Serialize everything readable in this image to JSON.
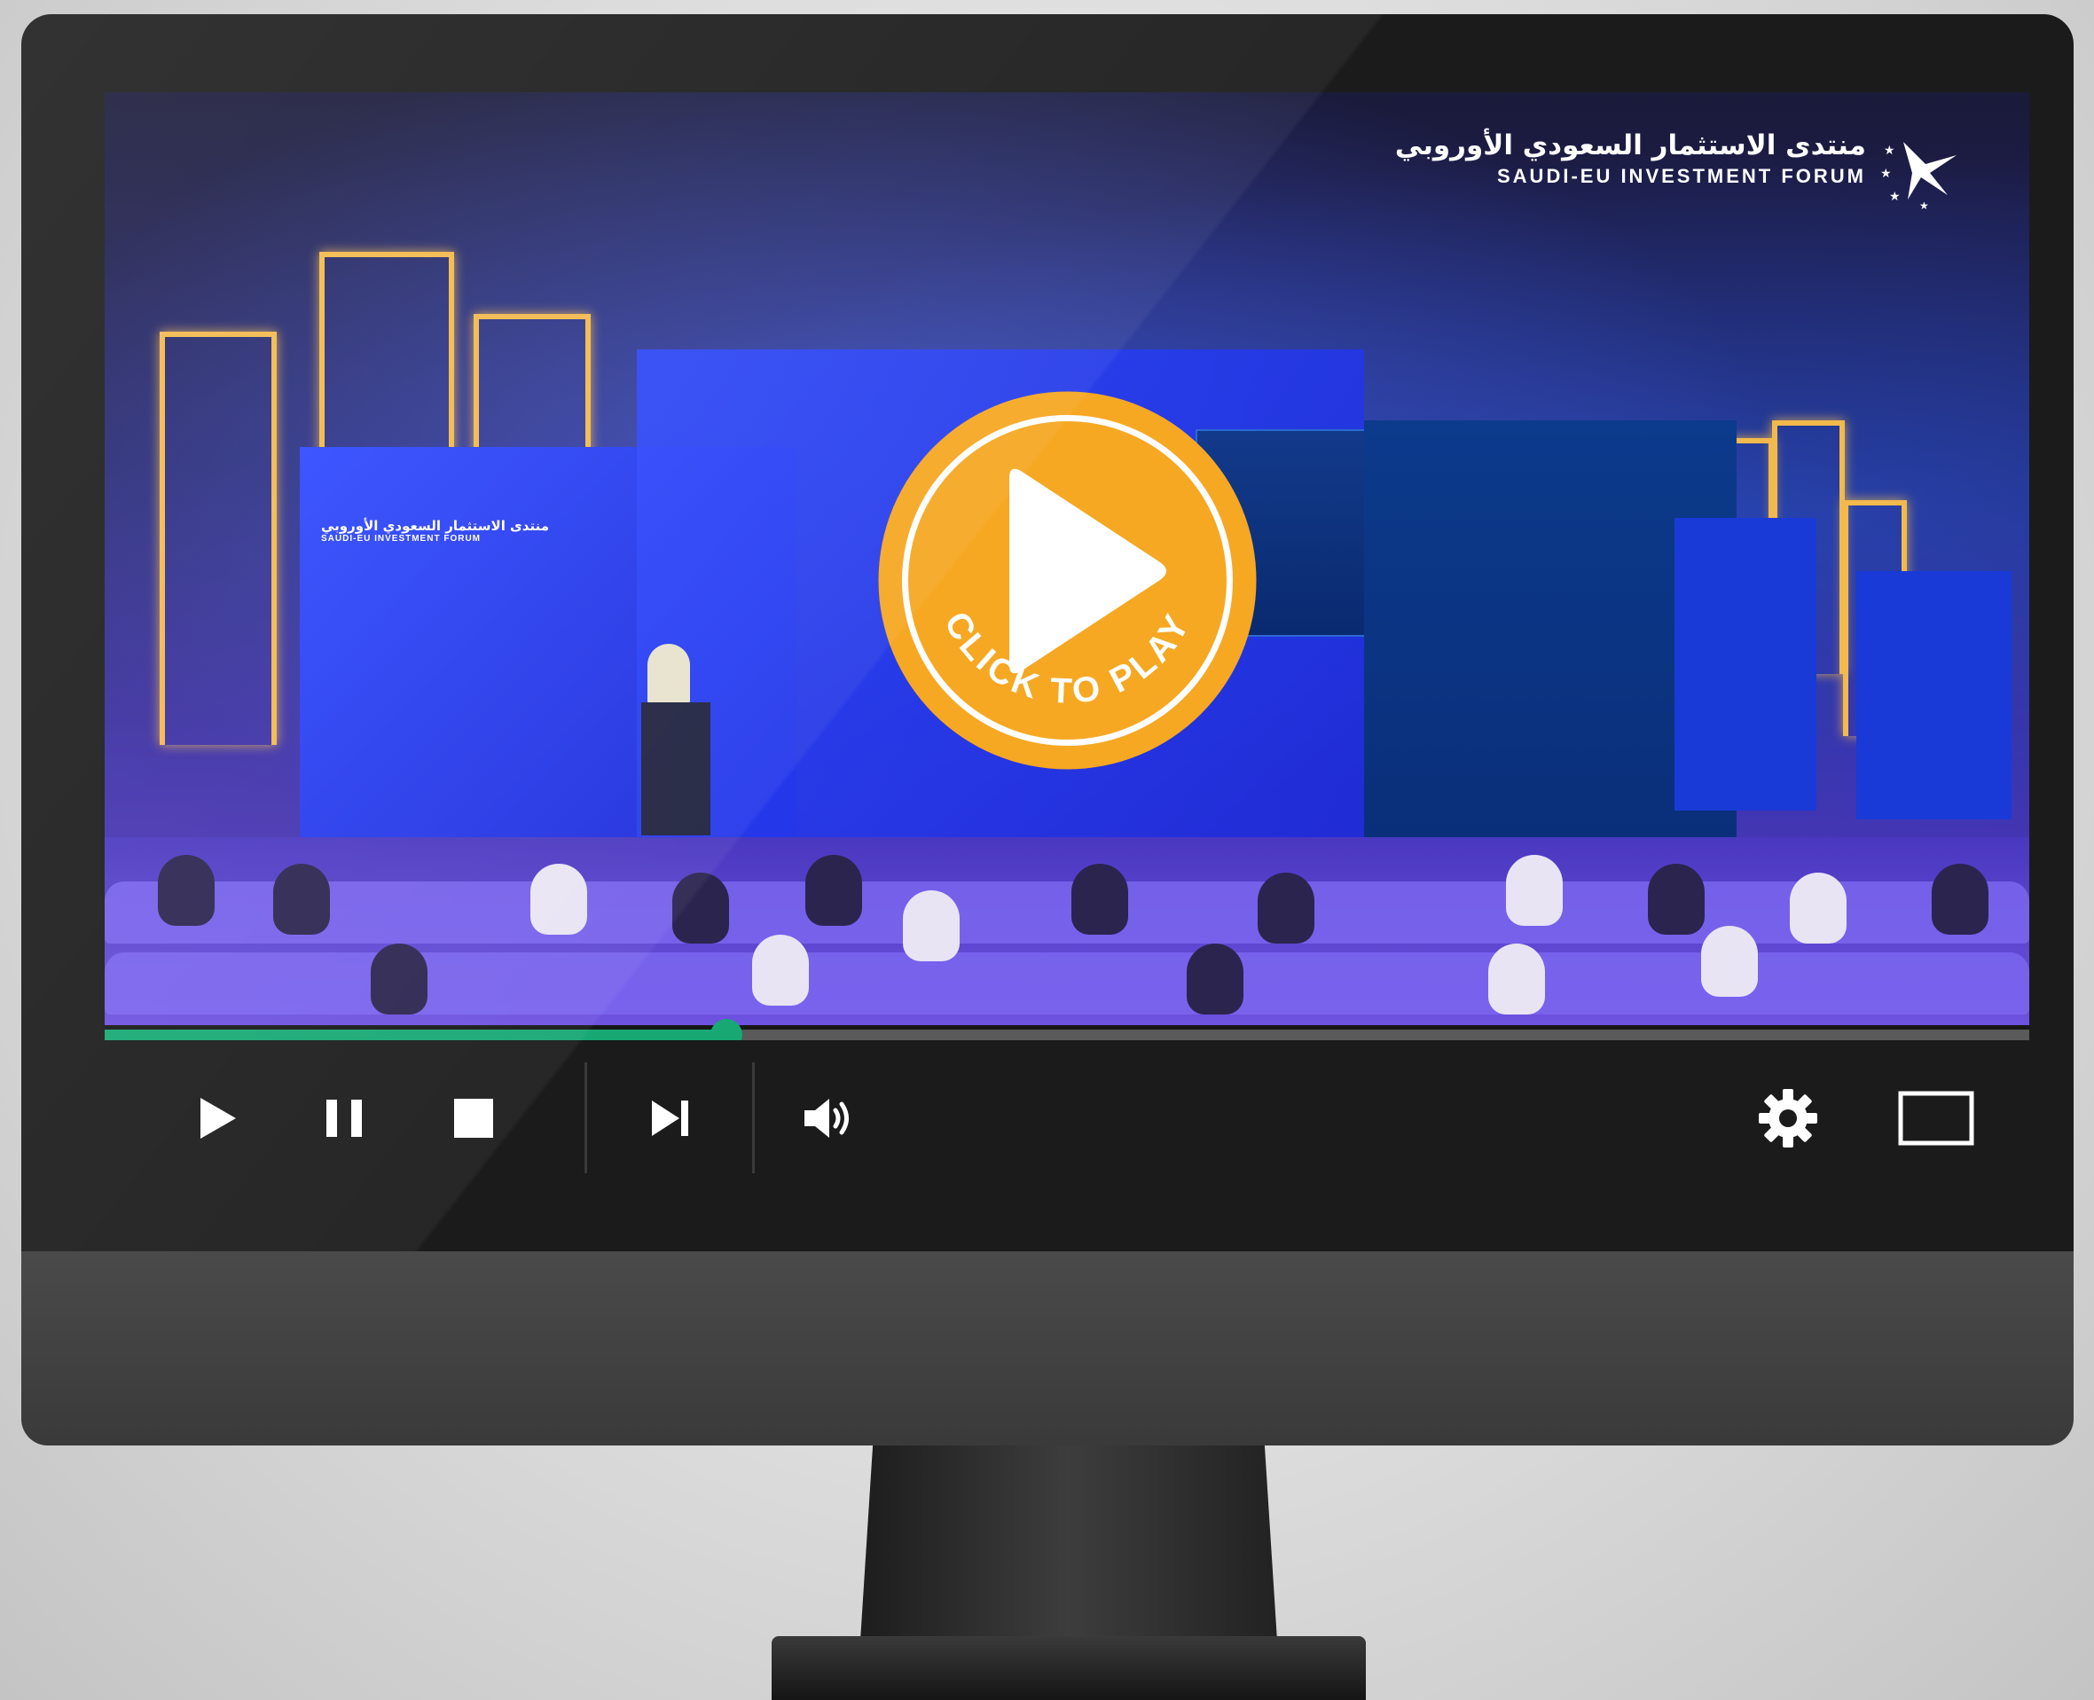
{
  "brand": {
    "arabic_name": "منتدى الاستثمار السعودي الأوروبي",
    "english_name": "SAUDI-EU INVESTMENT FORUM"
  },
  "stage_backdrop": {
    "arabic_name": "منتدى الاستثمار السعودي الأوروبي",
    "english_name": "SAUDI-EU INVESTMENT FORUM"
  },
  "play_overlay": {
    "label": "CLICK TO PLAY",
    "color": "#F6A823"
  },
  "player": {
    "progress_fraction": 0.323,
    "progress_color": "#17A874",
    "controls": [
      {
        "name": "play-icon"
      },
      {
        "name": "pause-icon"
      },
      {
        "name": "stop-icon"
      },
      {
        "name": "skip-next-icon"
      },
      {
        "name": "volume-icon"
      },
      {
        "name": "settings-gear-icon"
      },
      {
        "name": "fullscreen-icon"
      }
    ]
  }
}
